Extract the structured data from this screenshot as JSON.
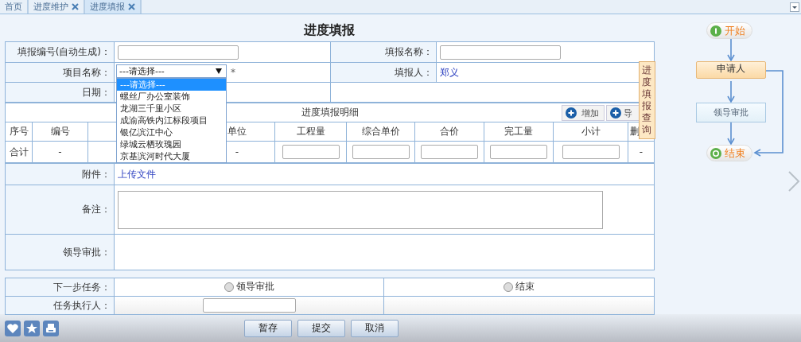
{
  "tabs": [
    {
      "label": "首页",
      "closable": false,
      "selected": false
    },
    {
      "label": "进度维护",
      "closable": true,
      "selected": false
    },
    {
      "label": "进度填报",
      "closable": true,
      "selected": true
    }
  ],
  "form": {
    "title": "进度填报",
    "serial": {
      "label": "填报编号(自动生成)："
    },
    "name": {
      "label": "填报名称："
    },
    "project": {
      "label": "项目名称：",
      "value": "---请选择---",
      "mark": "*",
      "open": true,
      "options": [
        {
          "label": "---请选择---",
          "selected": true
        },
        {
          "label": "螺丝厂办公室装饰",
          "selected": false
        },
        {
          "label": "龙湖三千里小区",
          "selected": false
        },
        {
          "label": "成渝高铁内江标段项目",
          "selected": false
        },
        {
          "label": "银亿滨江中心",
          "selected": false
        },
        {
          "label": "绿城云栖玫瑰园",
          "selected": false
        },
        {
          "label": "京基滨河时代大厦",
          "selected": false
        }
      ]
    },
    "reporter": {
      "label": "填报人：",
      "value": "郑义"
    },
    "date": {
      "label": "日期："
    }
  },
  "details": {
    "title": "进度填报明细",
    "buttons": [
      "增加",
      "导"
    ],
    "columns": [
      {
        "kind": "label",
        "label": "序号"
      },
      {
        "kind": "label",
        "label": "编号"
      },
      {
        "kind": "blank"
      },
      {
        "kind": "label",
        "label": "单位"
      },
      {
        "kind": "label",
        "label": "工程量"
      },
      {
        "kind": "label",
        "label": "综合单价"
      },
      {
        "kind": "label",
        "label": "合价"
      },
      {
        "kind": "label",
        "label": "完工量"
      },
      {
        "kind": "label",
        "label": "小计"
      },
      {
        "kind": "label",
        "label": "删"
      }
    ],
    "total_row": [
      {
        "kind": "text",
        "text": "合计"
      },
      {
        "kind": "text",
        "text": "-"
      },
      {
        "kind": "blank"
      },
      {
        "kind": "text",
        "text": "-"
      },
      {
        "kind": "input"
      },
      {
        "kind": "input"
      },
      {
        "kind": "input"
      },
      {
        "kind": "input"
      },
      {
        "kind": "input"
      },
      {
        "kind": "text",
        "text": "-"
      }
    ]
  },
  "attachment": {
    "label": "附件：",
    "link": "上传文件"
  },
  "remarks": {
    "label": "备注："
  },
  "approval": {
    "label": "领导审批："
  },
  "next_task": {
    "label": "下一步任务：",
    "options": [
      {
        "label": "领导审批",
        "selected": false
      },
      {
        "label": "结束",
        "selected": false
      }
    ]
  },
  "executor": {
    "label": "任务执行人："
  },
  "side_tab": {
    "label": "进度填报查询"
  },
  "flow": {
    "nodes": [
      {
        "kind": "start",
        "label": "开始"
      },
      {
        "kind": "step",
        "label": "申请人",
        "active": true
      },
      {
        "kind": "step",
        "label": "领导审批",
        "active": false
      },
      {
        "kind": "end",
        "label": "结束"
      }
    ]
  },
  "actions": [
    "暂存",
    "提交",
    "取消"
  ]
}
